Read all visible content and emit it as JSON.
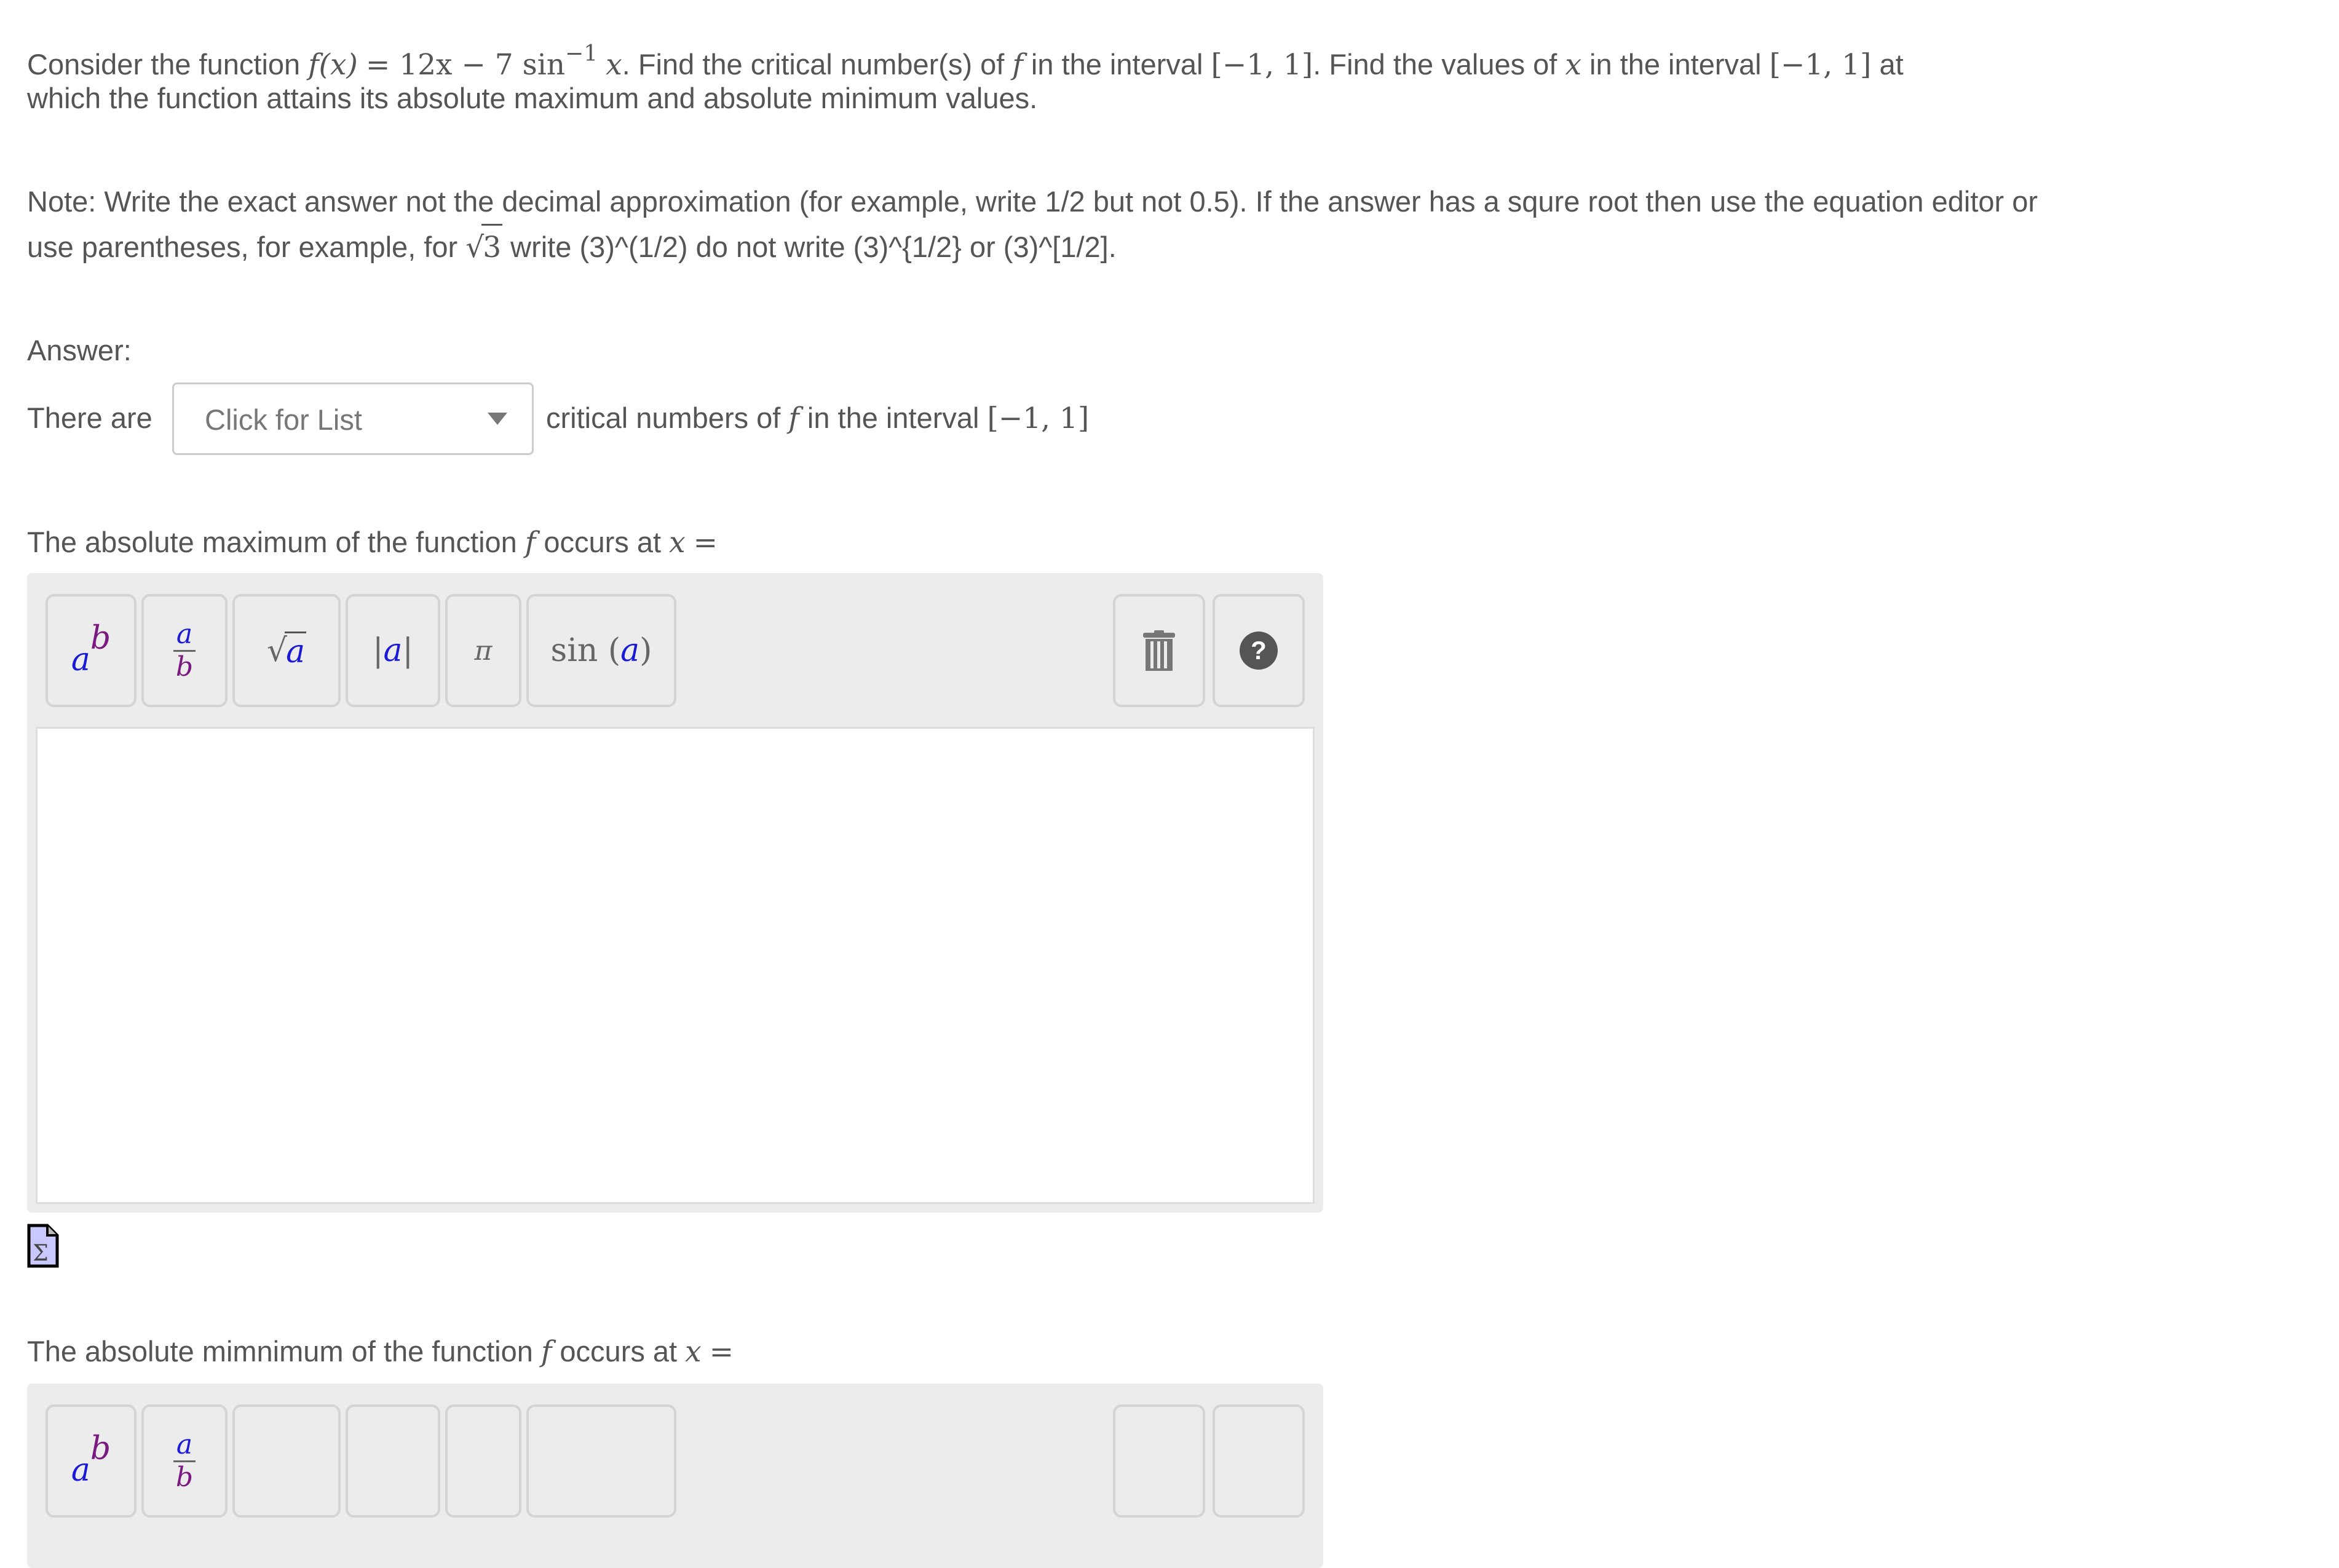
{
  "question": {
    "intro": "Consider the function",
    "function_lhs": "f(x)",
    "function_rhs_a": "= 12x − 7 sin",
    "function_sup": "−1",
    "function_rhs_b": "x",
    "after_function": ". Find the critical number(s) of",
    "f_symbol": "f",
    "interval_text_1": "in the interval",
    "interval": "[−1, 1]",
    "mid_text": ". Find the values of",
    "x_symbol": "x",
    "interval_text_2": "in the interval",
    "end_line1": "at",
    "line2": "which the function attains its absolute maximum and absolute minimum values."
  },
  "note": {
    "line1": "Note: Write the exact answer not the decimal approximation (for example, write 1/2 but not 0.5). If the answer has a squre root then use the equation editor or",
    "line2_a": "use parentheses, for example, for",
    "sqrt_arg": "3",
    "line2_b": "write (3)^(1/2) do not write (3)^{1/2} or (3)^[1/2]."
  },
  "answer_label": "Answer:",
  "critical": {
    "prefix": "There are",
    "dropdown_placeholder": "Click for List",
    "suffix": "critical numbers of",
    "f_symbol": "f",
    "interval_text": "in the interval",
    "interval": "[−1, 1]"
  },
  "max_prompt": {
    "text": "The absolute maximum of the function",
    "f": "f",
    "occurs": "occurs at",
    "x": "x",
    "eq": "="
  },
  "min_prompt": {
    "text": "The absolute mimnimum of the function",
    "f": "f",
    "occurs": "occurs at",
    "x": "x",
    "eq": "="
  },
  "toolbar": {
    "power": {
      "base": "a",
      "exp": "b"
    },
    "fraction": {
      "num": "a",
      "den": "b"
    },
    "sqrt": {
      "arg": "a"
    },
    "abs": {
      "arg": "a"
    },
    "pi": "π",
    "sin": {
      "fn": "sin",
      "arg": "a"
    },
    "trash_icon": "trash-icon",
    "help_icon": "help-icon"
  },
  "equation_icon": "Σ"
}
